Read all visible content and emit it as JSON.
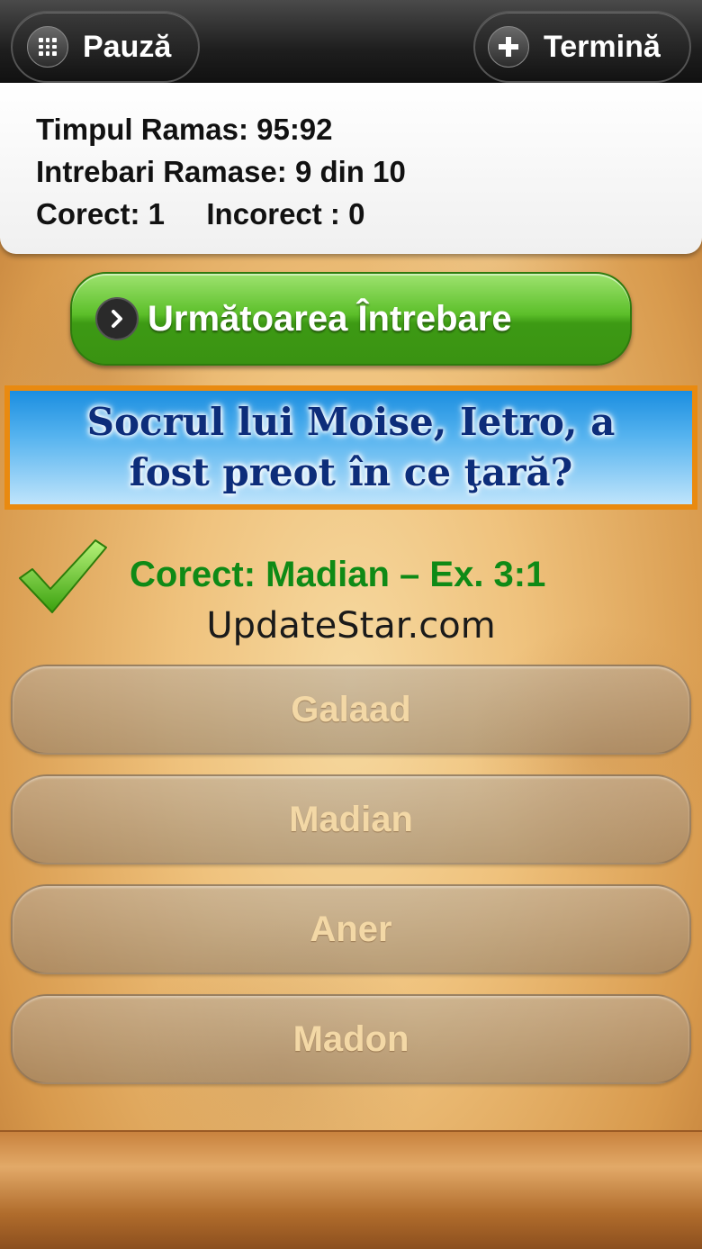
{
  "topbar": {
    "pause_label": "Pauză",
    "finish_label": "Termină",
    "pause_icon": "grid-icon",
    "finish_icon": "plus-icon"
  },
  "stats": {
    "time_remaining": "Timpul Ramas: 95:92",
    "questions_remaining": "Intrebari Ramase: 9 din 10",
    "correct": "Corect: 1",
    "incorrect": "Incorect : 0"
  },
  "next_button": {
    "label": "Următoarea Întrebare",
    "icon": "chevron-right-icon"
  },
  "question": {
    "text": "Socrul lui Moise, Ietro, a fost preot în ce ţară?"
  },
  "feedback": {
    "text": "Corect: Madian – Ex. 3:1",
    "icon": "checkmark-icon",
    "color": "#0f8a16"
  },
  "watermark": "UpdateStar.com",
  "answers": [
    {
      "label": "Galaad"
    },
    {
      "label": "Madian"
    },
    {
      "label": "Aner"
    },
    {
      "label": "Madon"
    }
  ],
  "colors": {
    "question_border": "#e98a10",
    "question_text": "#0d2d7a",
    "next_button": "#5cbf2a"
  }
}
